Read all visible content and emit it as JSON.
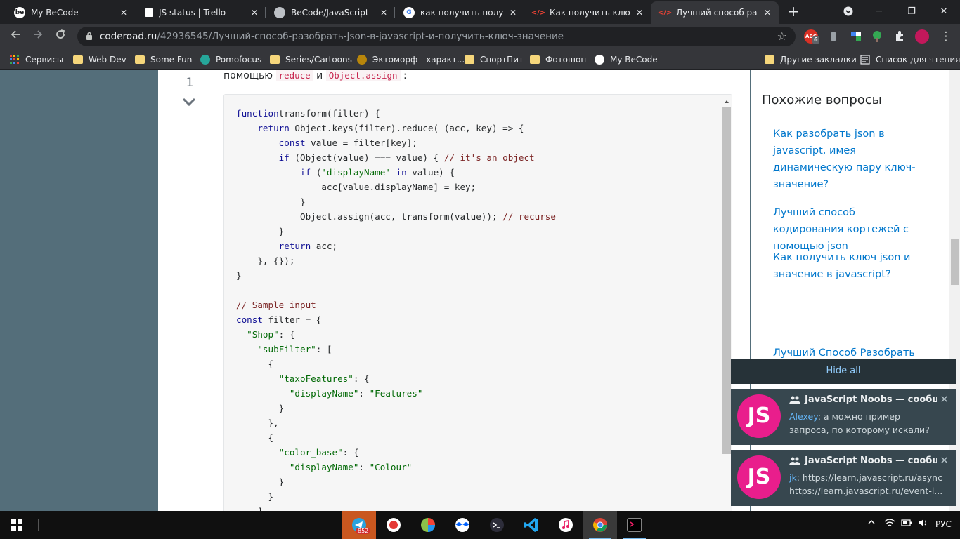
{
  "tabs": [
    {
      "title": "My BeCode",
      "favicon_color": "#ffffff",
      "favicon_glyph": "be"
    },
    {
      "title": "JS status | Trello",
      "favicon_color": "#ffffff",
      "favicon_glyph": ""
    },
    {
      "title": "BeCode/JavaScript - d",
      "favicon_color": "#bdc1c6",
      "favicon_glyph": ""
    },
    {
      "title": "как получить получит",
      "favicon_color": "#ffffff",
      "favicon_glyph": "G"
    },
    {
      "title": "Как получить ключ js",
      "favicon_color": "#ea4335",
      "favicon_glyph": "</>"
    },
    {
      "title": "Лучший способ разоб",
      "favicon_color": "#ea4335",
      "favicon_glyph": "</>"
    }
  ],
  "url": {
    "host": "coderoad.ru",
    "path": "/42936545/Лучший-способ-разобрать-Json-в-javascript-и-получить-ключ-значение"
  },
  "extension_badge": "6",
  "bookmarks": [
    {
      "label": "Сервисы",
      "kind": "apps"
    },
    {
      "label": "Web Dev",
      "kind": "folder"
    },
    {
      "label": "Some Fun",
      "kind": "folder"
    },
    {
      "label": "Pomofocus",
      "kind": "site"
    },
    {
      "label": "Series/Cartoons",
      "kind": "folder"
    },
    {
      "label": "Эктоморф - характ...",
      "kind": "site"
    },
    {
      "label": "СпортПит",
      "kind": "folder"
    },
    {
      "label": "Фотошоп",
      "kind": "folder"
    },
    {
      "label": "My BeCode",
      "kind": "site"
    }
  ],
  "bookmarks_right": {
    "other": "Другие закладки",
    "reading_list": "Список для чтения"
  },
  "answer": {
    "vote_count": "1",
    "intro_prefix": "помощью",
    "intro_code1": "reduce",
    "intro_mid": "и",
    "intro_code2": "Object.assign",
    "intro_suffix": ":"
  },
  "code_lines": [
    [
      [
        "kw",
        "function"
      ],
      [
        "",
        "transform(filter) {"
      ]
    ],
    [
      [
        "",
        "    "
      ],
      [
        "kw",
        "return"
      ],
      [
        "",
        " Object.keys(filter).reduce( (acc, key) => {"
      ]
    ],
    [
      [
        "",
        "        "
      ],
      [
        "kw",
        "const"
      ],
      [
        "",
        " value = filter[key];"
      ]
    ],
    [
      [
        "",
        "        "
      ],
      [
        "kw",
        "if"
      ],
      [
        "",
        " (Object(value) === value) { "
      ],
      [
        "cm",
        "// it's an object"
      ]
    ],
    [
      [
        "",
        "            "
      ],
      [
        "kw",
        "if"
      ],
      [
        "",
        " ("
      ],
      [
        "str",
        "'displayName'"
      ],
      [
        "",
        " "
      ],
      [
        "kw",
        "in"
      ],
      [
        "",
        " value) {"
      ]
    ],
    [
      [
        "",
        "                acc[value.displayName] = key;"
      ]
    ],
    [
      [
        "",
        "            }"
      ]
    ],
    [
      [
        "",
        "            Object.assign(acc, transform(value)); "
      ],
      [
        "cm",
        "// recurse"
      ]
    ],
    [
      [
        "",
        "        }"
      ]
    ],
    [
      [
        "",
        "        "
      ],
      [
        "kw",
        "return"
      ],
      [
        "",
        " acc;"
      ]
    ],
    [
      [
        "",
        "    }, {});"
      ]
    ],
    [
      [
        "",
        "}"
      ]
    ],
    [
      [
        "",
        ""
      ]
    ],
    [
      [
        "cm",
        "// Sample input"
      ]
    ],
    [
      [
        "kw",
        "const"
      ],
      [
        "",
        " filter = {"
      ]
    ],
    [
      [
        "",
        "  "
      ],
      [
        "str",
        "\"Shop\""
      ],
      [
        "",
        ": {"
      ]
    ],
    [
      [
        "",
        "    "
      ],
      [
        "str",
        "\"subFilter\""
      ],
      [
        "",
        ": ["
      ]
    ],
    [
      [
        "",
        "      {"
      ]
    ],
    [
      [
        "",
        "        "
      ],
      [
        "str",
        "\"taxoFeatures\""
      ],
      [
        "",
        ": {"
      ]
    ],
    [
      [
        "",
        "          "
      ],
      [
        "str",
        "\"displayName\""
      ],
      [
        "",
        ": "
      ],
      [
        "str",
        "\"Features\""
      ]
    ],
    [
      [
        "",
        "        }"
      ]
    ],
    [
      [
        "",
        "      },"
      ]
    ],
    [
      [
        "",
        "      {"
      ]
    ],
    [
      [
        "",
        "        "
      ],
      [
        "str",
        "\"color_base\""
      ],
      [
        "",
        ": {"
      ]
    ],
    [
      [
        "",
        "          "
      ],
      [
        "str",
        "\"displayName\""
      ],
      [
        "",
        ": "
      ],
      [
        "str",
        "\"Colour\""
      ]
    ],
    [
      [
        "",
        "        }"
      ]
    ],
    [
      [
        "",
        "      }"
      ]
    ],
    [
      [
        "",
        "    ]"
      ]
    ]
  ],
  "sidebar": {
    "title": "Похожие вопросы",
    "links": [
      "Как разобрать json в javascript, имея динамическую пару ключ-значение?",
      "Лучший способ кодирования кортежей с помощью json",
      "Как получить ключ json и значение в javascript?",
      "Лучший Способ Разобрать"
    ]
  },
  "notifications": {
    "hide_all": "Hide all",
    "items": [
      {
        "avatar": "JS",
        "title": "JavaScript Noobs — сообщ...",
        "author": "Alexey",
        "line1": ": а можно пример",
        "line2": "запроса, по которому искали?"
      },
      {
        "avatar": "JS",
        "title": "JavaScript Noobs — сообщ...",
        "author": "jk",
        "line1": ": https://learn.javascript.ru/async",
        "line2": "https://learn.javascript.ru/event-l..."
      }
    ]
  },
  "taskbar": {
    "telegram_badge": "852",
    "language": "РУС"
  },
  "colors": {
    "chrome_dark": "#202124",
    "toolbar": "#35363a",
    "page_bg": "#546e7a",
    "link": "#0077cc",
    "notif_bg": "#37474f",
    "avatar": "#e91e8c"
  }
}
